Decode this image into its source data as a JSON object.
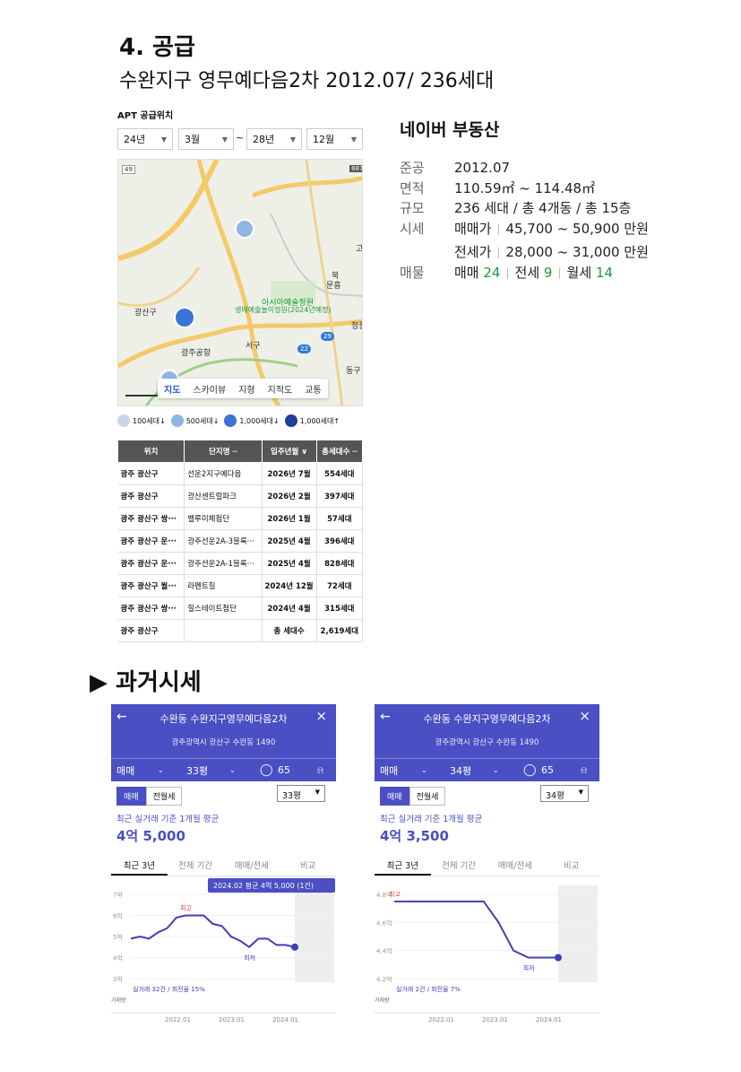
{
  "heading": "4. 공급",
  "subtitle": "수완지구 영무예다음2차 2012.07/ 236세대",
  "apt": {
    "title": "APT 공급위치",
    "filters": [
      "24년",
      "3월",
      "28년",
      "12월"
    ],
    "tilde": "~",
    "map_labels": [
      "광산구",
      "아시아예술정원",
      "생태예술놀이정원(2024년예정)",
      "광주공항",
      "서구",
      "북",
      "문흥",
      "청풍",
      "동구",
      "고",
      "49",
      "887",
      "22",
      "29"
    ],
    "map_tabs": [
      "지도",
      "스카이뷰",
      "지형",
      "지적도",
      "교통"
    ],
    "map_scale": "4km",
    "legend": [
      "100세대↓",
      "500세대↓",
      "1,000세대↓",
      "1,000세대↑"
    ],
    "table_headers": [
      "위치",
      "단지명 ─",
      "입주년월 ∨",
      "총세대수 ─"
    ],
    "table_rows": [
      [
        "광주 광산구",
        "선운2지구예다음",
        "2026년 7월",
        "554세대"
      ],
      [
        "광주 광산구",
        "광산센트럴파크",
        "2026년 2월",
        "397세대"
      ],
      [
        "광주 광산구 쌍···",
        "벨루미체첨단",
        "2026년 1월",
        "57세대"
      ],
      [
        "광주 광산구 운···",
        "광주선운2A-3블록···",
        "2025년 4월",
        "396세대"
      ],
      [
        "광주 광산구 운···",
        "광주선운2A-1블록···",
        "2025년 4월",
        "828세대"
      ],
      [
        "광주 광산구 월···",
        "라펜트힐",
        "2024년 12월",
        "72세대"
      ],
      [
        "광주 광산구 쌍···",
        "힐스테이트첨단",
        "2024년 4월",
        "315세대"
      ],
      [
        "광주 광산구",
        "",
        "총 세대수",
        "2,619세대"
      ]
    ]
  },
  "naver": {
    "title": "네이버 부동산",
    "rows": [
      {
        "k": "준공",
        "v": "2012.07"
      },
      {
        "k": "면적",
        "v": "110.59㎡ ~ 114.48㎡"
      },
      {
        "k": "규모",
        "v": "236 세대 / 총 4개동 / 총 15층"
      }
    ],
    "price_key": "시세",
    "sale_label": "매매가",
    "sale_value": "45,700 ~ 50,900 만원",
    "jeonse_label": "전세가",
    "jeonse_value": "28,000 ~ 31,000 만원",
    "listing_key": "매물",
    "listing_sale_label": "매매",
    "listing_sale_count": "24",
    "listing_jeonse_label": "전세",
    "listing_jeonse_count": "9",
    "listing_monthly_label": "월세",
    "listing_monthly_count": "14",
    "separator": "|"
  },
  "past_heading": "▶ 과거시세",
  "apps": [
    {
      "title": "수완동 수완지구영무예다음2차",
      "address": "광주광역시 광산구 수완동 1490",
      "trade": "매매",
      "size": "33평",
      "comments": "65",
      "seg": [
        "매매",
        "전월세"
      ],
      "dropdown": "33평",
      "avg_label": "최근 실거래 기준 1개월 평균",
      "avg_value": "4억 5,000",
      "tabs": [
        "최근 3년",
        "전체 기간",
        "매매/전세",
        "비교"
      ],
      "tooltip": "2024.02 평균 4억 5,000 (1건)",
      "y_ticks": [
        "7억",
        "6억",
        "5억",
        "4억",
        "3억"
      ],
      "x_ticks": [
        "2022.01",
        "2023.01",
        "2024.01"
      ],
      "high_label": "최고",
      "low_label": "최저",
      "stats": "실거래 32건 / 회전율 15%",
      "vol_label": "거래량"
    },
    {
      "title": "수완동 수완지구영무예다음2차",
      "address": "광주광역시 광산구 수완동 1490",
      "trade": "매매",
      "size": "34평",
      "comments": "65",
      "seg": [
        "매매",
        "전월세"
      ],
      "dropdown": "34평",
      "avg_label": "최근 실거래 기준 1개월 평균",
      "avg_value": "4억 3,500",
      "tabs": [
        "최근 3년",
        "전체 기간",
        "매매/전세",
        "비교"
      ],
      "tooltip": "",
      "y_ticks": [
        "4.8억",
        "4.6억",
        "4.4억",
        "4.2억"
      ],
      "x_ticks": [
        "2022.01",
        "2023.01",
        "2024.01"
      ],
      "high_label": "최고",
      "low_label": "최저",
      "stats": "실거래 2건 / 회전율 7%",
      "vol_label": "거래량"
    }
  ],
  "chart_data": [
    {
      "type": "line",
      "series": [
        {
          "values": [
            4.9,
            5.0,
            4.9,
            5.2,
            5.4,
            5.9,
            6.0,
            6.0,
            6.0,
            5.6,
            5.5,
            5.0,
            4.8,
            4.5,
            4.9,
            4.9,
            4.6,
            4.6,
            4.5
          ]
        }
      ],
      "ylim": [
        3,
        7
      ]
    },
    {
      "type": "line",
      "series": [
        {
          "values": [
            4.75,
            4.75,
            4.75,
            4.75,
            4.75,
            4.75,
            4.75,
            4.6,
            4.4,
            4.35,
            4.35,
            4.35
          ]
        }
      ],
      "ylim": [
        4.2,
        4.8
      ]
    }
  ],
  "colors": {
    "brand": "#4a4fc4",
    "green": "#1a9a3a"
  }
}
